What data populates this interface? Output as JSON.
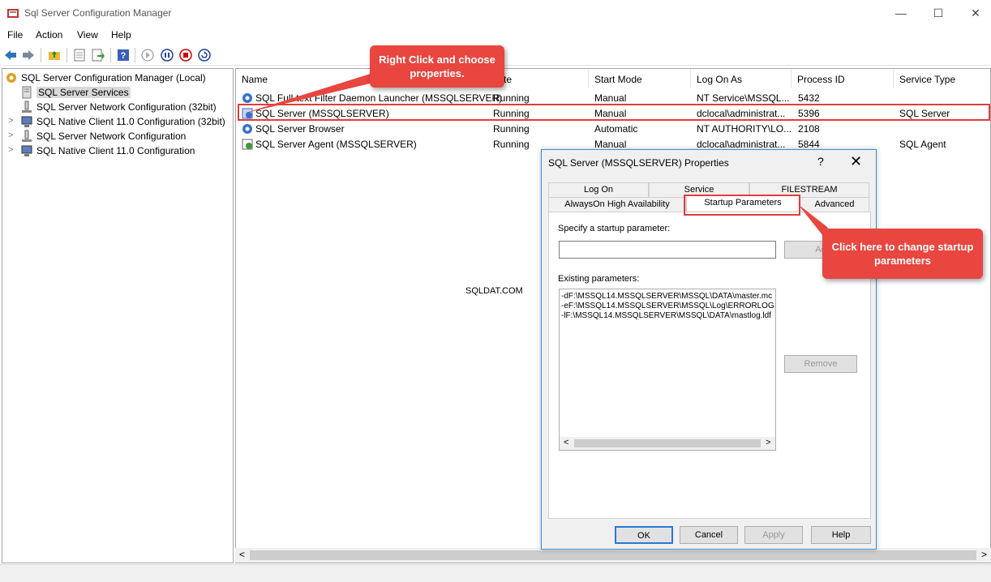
{
  "window": {
    "title": "Sql Server Configuration Manager",
    "minimize": "—",
    "maximize": "☐",
    "close": "✕"
  },
  "menu": {
    "items": [
      "File",
      "Action",
      "View",
      "Help"
    ]
  },
  "toolbar": {
    "icons": [
      "back-icon",
      "forward-icon",
      "up-folder-icon",
      "properties-icon",
      "export-icon",
      "help-icon",
      "start-icon",
      "pause-icon",
      "stop-icon",
      "restart-icon"
    ]
  },
  "tree": {
    "root": "SQL Server Configuration Manager (Local)",
    "items": [
      {
        "label": "SQL Server Services",
        "selected": true
      },
      {
        "label": "SQL Server Network Configuration (32bit)"
      },
      {
        "label": "SQL Native Client 11.0 Configuration (32bit)"
      },
      {
        "label": "SQL Server Network Configuration"
      },
      {
        "label": "SQL Native Client 11.0 Configuration"
      }
    ],
    "expander": ">"
  },
  "list": {
    "columns": [
      "Name",
      "te",
      "Start Mode",
      "Log On As",
      "Process ID",
      "Service Type"
    ],
    "rows": [
      {
        "name": "SQL Full-text Filter Daemon Launcher (MSSQLSERVER)",
        "state": "Running",
        "start_mode": "Manual",
        "log_on_as": "NT Service\\MSSQL...",
        "pid": "5432",
        "type": ""
      },
      {
        "name": "SQL Server (MSSQLSERVER)",
        "state": "Running",
        "start_mode": "Manual",
        "log_on_as": "dclocal\\administrat...",
        "pid": "5396",
        "type": "SQL Server"
      },
      {
        "name": "SQL Server Browser",
        "state": "Running",
        "start_mode": "Automatic",
        "log_on_as": "NT AUTHORITY\\LO...",
        "pid": "2108",
        "type": ""
      },
      {
        "name": "SQL Server Agent (MSSQLSERVER)",
        "state": "Running",
        "start_mode": "Manual",
        "log_on_as": "dclocal\\administrat...",
        "pid": "5844",
        "type": "SQL Agent"
      }
    ],
    "scroll_left": "<",
    "scroll_right": ">"
  },
  "dialog": {
    "title": "SQL Server (MSSQLSERVER) Properties",
    "help": "?",
    "close": "✕",
    "tabs_row1": [
      "Log On",
      "Service",
      "FILESTREAM"
    ],
    "tabs_row2": [
      "AlwaysOn High Availability",
      "Startup Parameters",
      "Advanced"
    ],
    "specify_label": "Specify a startup parameter:",
    "param_input_value": "",
    "add_button": "Ad",
    "existing_label": "Existing parameters:",
    "parameters": [
      "-dF:\\MSSQL14.MSSQLSERVER\\MSSQL\\DATA\\master.mc",
      "-eF:\\MSSQL14.MSSQLSERVER\\MSSQL\\Log\\ERRORLOG",
      "-lF:\\MSSQL14.MSSQLSERVER\\MSSQL\\DATA\\mastlog.ldf"
    ],
    "remove_button": "Remove",
    "ok": "OK",
    "cancel": "Cancel",
    "apply": "Apply",
    "help_button": "Help",
    "scroll_left": "<",
    "scroll_right": ">"
  },
  "callouts": {
    "right_click": "Right Click and choose properties.",
    "change_params": "Click here to change startup parameters"
  },
  "watermark": "SQLDAT.COM",
  "colors": {
    "highlight": "#e23d3d",
    "callout": "#e8463f",
    "dialog_border": "#3d8fd1"
  }
}
